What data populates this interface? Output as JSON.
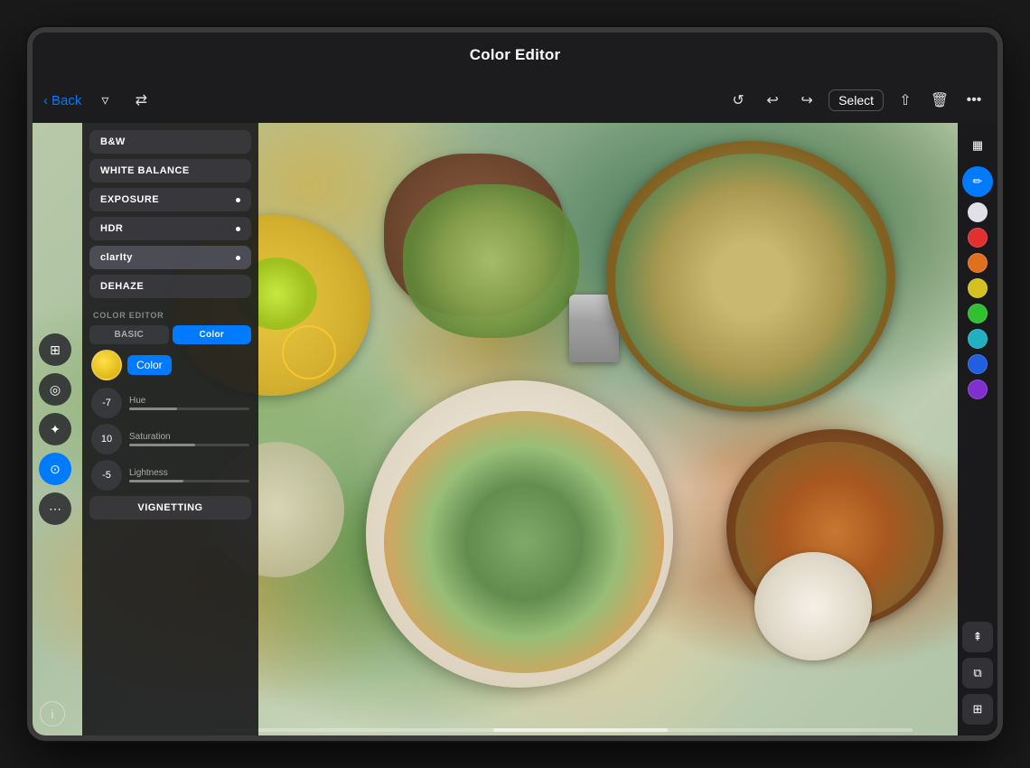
{
  "app": {
    "title": "Color Editor"
  },
  "toolbar": {
    "back_label": "Back",
    "select_label": "Select"
  },
  "sidebar": {
    "tools": [
      {
        "label": "B&W",
        "has_indicator": false
      },
      {
        "label": "WHITE BALANCE",
        "has_indicator": false
      },
      {
        "label": "EXPOSURE",
        "has_indicator": true
      },
      {
        "label": "HDR",
        "has_indicator": true
      },
      {
        "label": "clarIty",
        "has_indicator": true
      },
      {
        "label": "DEHAZE",
        "has_indicator": false
      }
    ],
    "color_editor_label": "COLOR EDITOR",
    "tabs": [
      {
        "label": "BASIC",
        "active": false
      },
      {
        "label": "Color",
        "active": true
      }
    ],
    "hue_label": "Hue",
    "hue_value": "-7",
    "saturation_label": "Saturation",
    "saturation_value": "10",
    "lightness_label": "Lightness",
    "lightness_value": "-5",
    "vignetting_label": "VIGNETTING"
  },
  "colors": {
    "red": "#e03030",
    "orange": "#e07020",
    "yellow": "#d4c020",
    "green": "#30c030",
    "teal": "#20b0c0",
    "blue": "#2060e0",
    "purple": "#8030d0"
  },
  "left_icons": [
    {
      "name": "layers-icon",
      "symbol": "⊞",
      "active": false
    },
    {
      "name": "lens-icon",
      "symbol": "◎",
      "active": false
    },
    {
      "name": "brush-icon",
      "symbol": "✦",
      "active": false
    },
    {
      "name": "filter-icon",
      "symbol": "⊙",
      "active": true
    },
    {
      "name": "dots-icon",
      "symbol": "⋯",
      "active": false
    }
  ],
  "right_icons": [
    {
      "name": "texture-icon",
      "symbol": "▦",
      "active": false
    },
    {
      "name": "pen-icon",
      "symbol": "✏",
      "active": true
    }
  ]
}
